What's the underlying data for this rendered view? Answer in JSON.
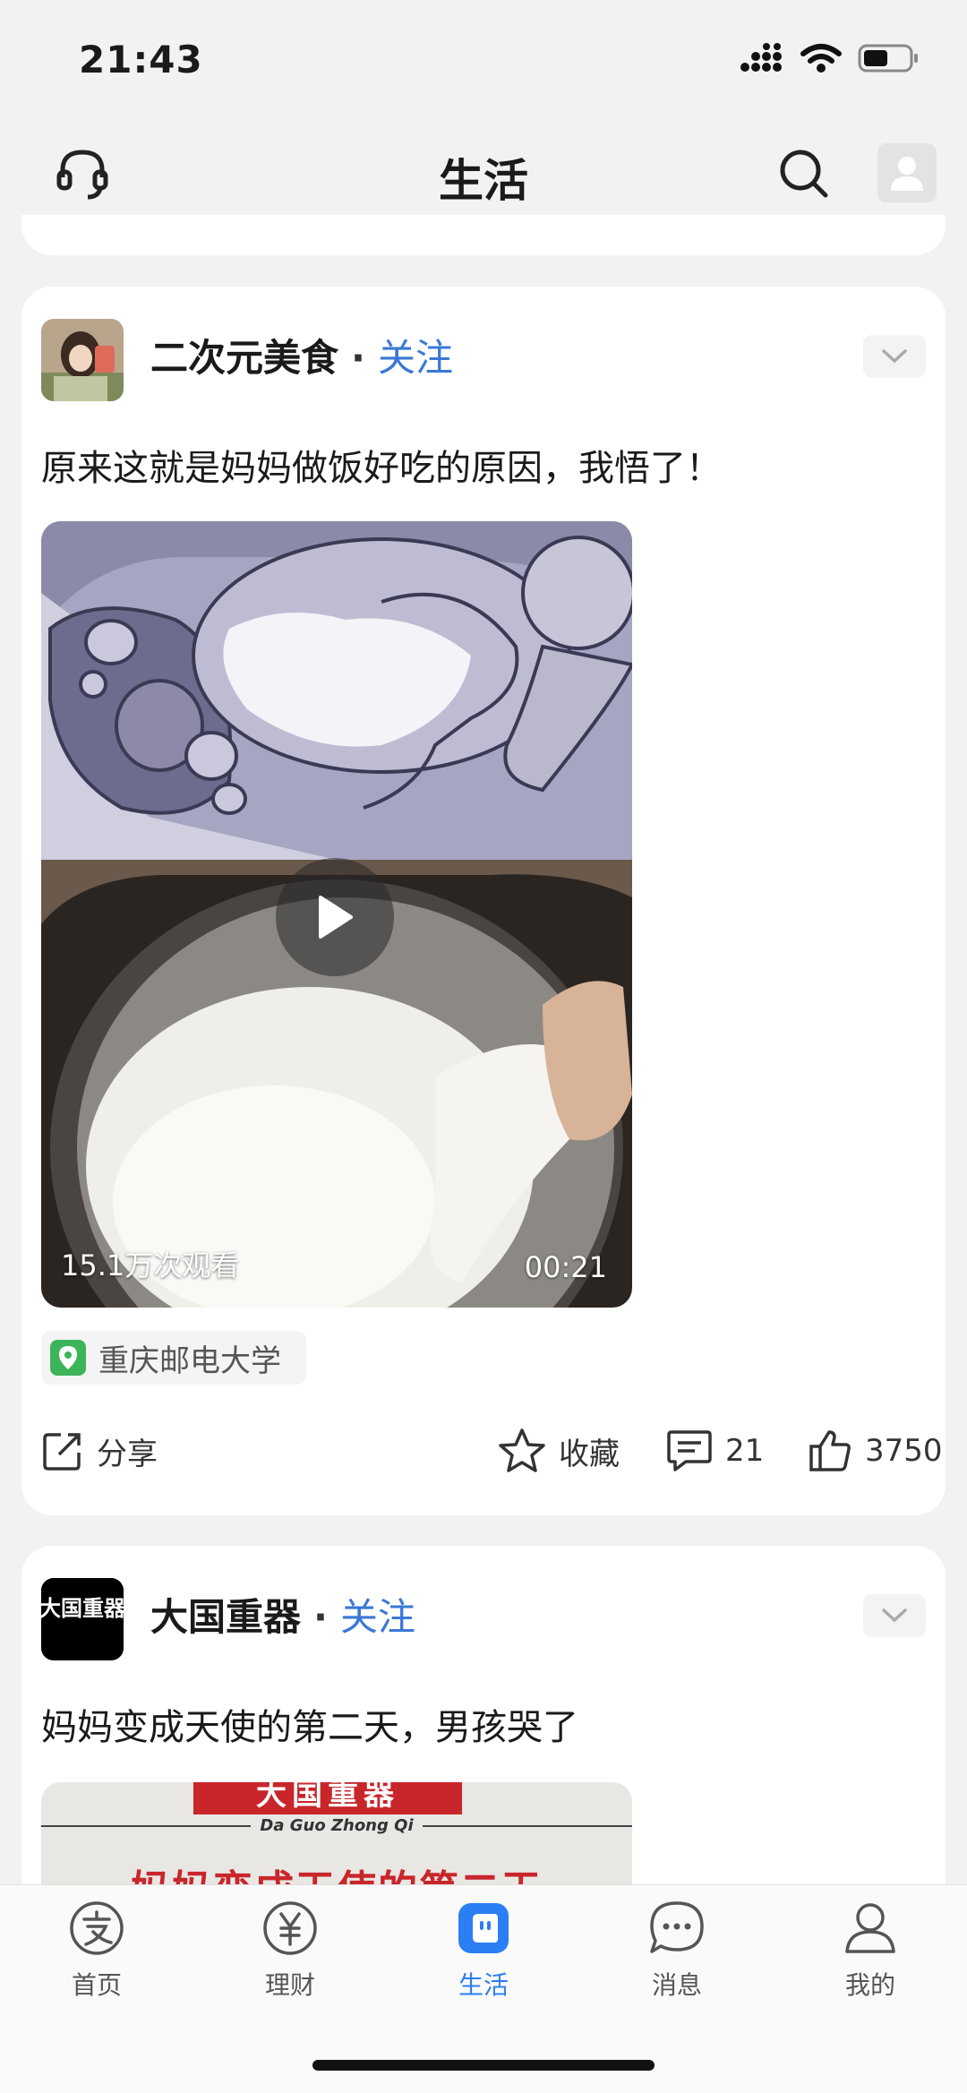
{
  "status_bar": {
    "time": "21:43"
  },
  "nav": {
    "title": "生活"
  },
  "feed": [
    {
      "author": "二次元美食",
      "follow_label": "关注",
      "dot": "·",
      "text": "原来这就是妈妈做饭好吃的原因，我悟了！",
      "video": {
        "views": "15.1万次观看",
        "duration": "00:21"
      },
      "location": "重庆邮电大学",
      "actions": {
        "share": "分享",
        "favorite": "收藏",
        "comments": "21",
        "likes": "3750"
      }
    },
    {
      "author": "大国重器",
      "avatar_text": "大国重器",
      "follow_label": "关注",
      "dot": "·",
      "text": "妈妈变成天使的第二天，男孩哭了",
      "thumb_banner": "大国重器",
      "thumb_sub": "Da Guo Zhong Qi",
      "thumb_title": "妈妈变成天使的第二天"
    }
  ],
  "tab_bar": {
    "tabs": [
      {
        "label": "首页",
        "icon": "alipay-icon"
      },
      {
        "label": "理财",
        "icon": "yuan-icon"
      },
      {
        "label": "生活",
        "icon": "life-icon",
        "active": true
      },
      {
        "label": "消息",
        "icon": "message-icon"
      },
      {
        "label": "我的",
        "icon": "profile-icon"
      }
    ]
  },
  "colors": {
    "accent": "#2c7ef5",
    "follow": "#3a78d6",
    "location_pin": "#3cb55a"
  }
}
